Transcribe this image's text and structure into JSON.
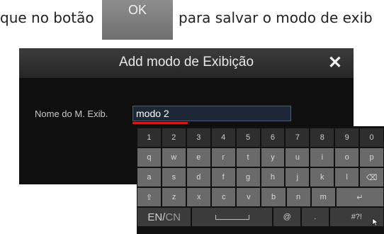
{
  "instruction": {
    "before": "que no botão",
    "button_label": "OK",
    "after": "para salvar o modo de exib"
  },
  "dialog": {
    "title": "Add modo de Exibição",
    "close_glyph": "✕",
    "field_label": "Nome do M. Exib.",
    "field_value": "modo 2"
  },
  "keyboard": {
    "row1": [
      "1",
      "2",
      "3",
      "4",
      "5",
      "6",
      "7",
      "8",
      "9",
      "0"
    ],
    "row2": [
      "q",
      "w",
      "e",
      "r",
      "t",
      "y",
      "u",
      "i",
      "o",
      "p"
    ],
    "row3": [
      "a",
      "s",
      "d",
      "f",
      "g",
      "h",
      "j",
      "k",
      "l",
      "⌫"
    ],
    "row4": [
      "⇧",
      "z",
      "x",
      "c",
      "v",
      "b",
      "n",
      "m",
      "↵"
    ],
    "row5": {
      "lang_en": "EN/",
      "lang_cn": "CN",
      "space": "",
      "at": "@",
      "dot": ".",
      "symbols": "#?!"
    }
  },
  "colors": {
    "dialog_bg": "#0f0f0f",
    "accent_red": "#d61a1a",
    "field_border": "#4a5a72"
  }
}
